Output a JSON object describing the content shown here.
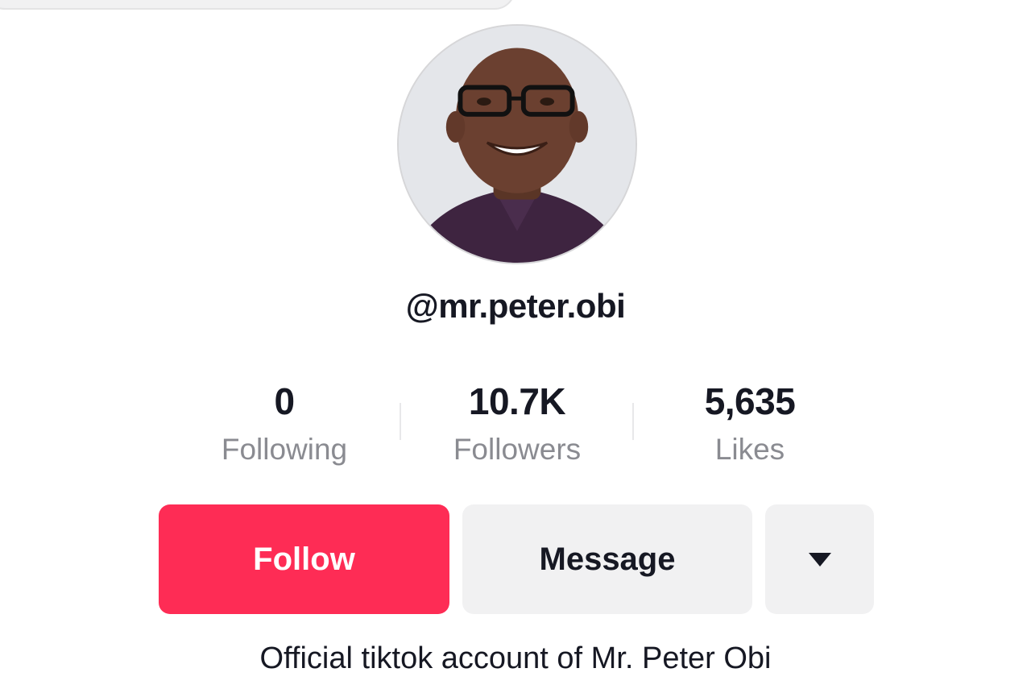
{
  "profile": {
    "username": "@mr.peter.obi",
    "bio": "Official tiktok account of Mr. Peter Obi"
  },
  "stats": {
    "following": {
      "value": "0",
      "label": "Following"
    },
    "followers": {
      "value": "10.7K",
      "label": "Followers"
    },
    "likes": {
      "value": "5,635",
      "label": "Likes"
    }
  },
  "actions": {
    "follow_label": "Follow",
    "message_label": "Message",
    "more_icon": "caret-down-icon"
  },
  "colors": {
    "follow_button": "#fe2c55",
    "secondary_button": "#f1f1f2",
    "muted_text": "#8a8b91",
    "primary_text": "#161823"
  }
}
